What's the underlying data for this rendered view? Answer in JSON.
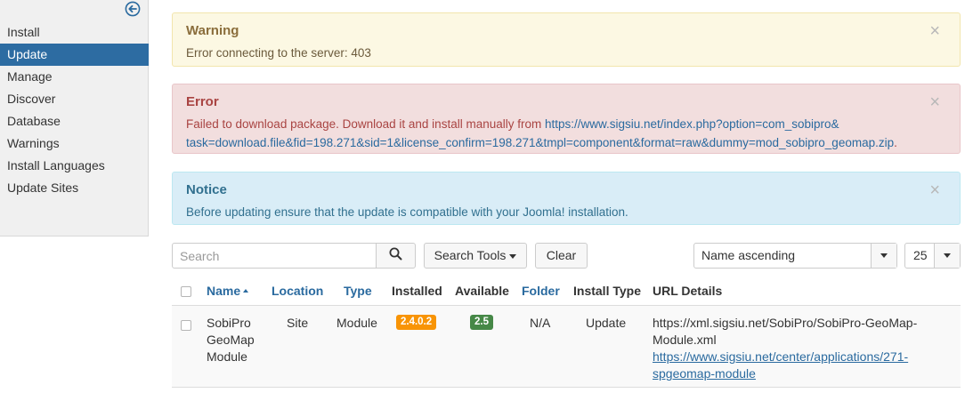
{
  "sidebar": {
    "items": [
      {
        "label": "Install",
        "active": false
      },
      {
        "label": "Update",
        "active": true
      },
      {
        "label": "Manage",
        "active": false
      },
      {
        "label": "Discover",
        "active": false
      },
      {
        "label": "Database",
        "active": false
      },
      {
        "label": "Warnings",
        "active": false
      },
      {
        "label": "Install Languages",
        "active": false
      },
      {
        "label": "Update Sites",
        "active": false
      }
    ]
  },
  "alerts": {
    "warning": {
      "title": "Warning",
      "text": "Error connecting to the server: 403",
      "close": "×"
    },
    "error": {
      "title": "Error",
      "text_before": "Failed to download package. Download it and install manually from ",
      "link_line1": "https://www.sigsiu.net/index.php?option=com_sobipro&",
      "link_line2": "task=download.file&fid=198.271&sid=1&license_confirm=198.271&tmpl=component&format=raw&dummy=mod_sobipro_geomap.zip",
      "text_after": ".",
      "close": "×"
    },
    "notice": {
      "title": "Notice",
      "text": "Before updating ensure that the update is compatible with your Joomla! installation.",
      "close": "×"
    }
  },
  "toolbar": {
    "search_placeholder": "Search",
    "search_tools_label": "Search Tools",
    "clear_label": "Clear",
    "sort_value": "Name ascending",
    "limit_value": "25"
  },
  "table": {
    "headers": {
      "name": "Name",
      "location": "Location",
      "type": "Type",
      "installed": "Installed",
      "available": "Available",
      "folder": "Folder",
      "install_type": "Install Type",
      "url_details": "URL Details"
    },
    "rows": [
      {
        "name_line1": "SobiPro",
        "name_line2": "GeoMap",
        "name_line3": "Module",
        "location": "Site",
        "type": "Module",
        "installed": "2.4.0.2",
        "available": "2.5",
        "folder": "N/A",
        "install_type": "Update",
        "url_line1": "https://xml.sigsiu.net/SobiPro/SobiPro-GeoMap-",
        "url_line2": "Module.xml",
        "details_line1": "https://www.sigsiu.net/center/applications/271-",
        "details_line2": "spgeomap-module"
      }
    ]
  },
  "colors": {
    "sidebar_active": "#2d6ca2",
    "badge_installed": "#f89406",
    "badge_available": "#468847",
    "link": "#2a6a9f"
  }
}
